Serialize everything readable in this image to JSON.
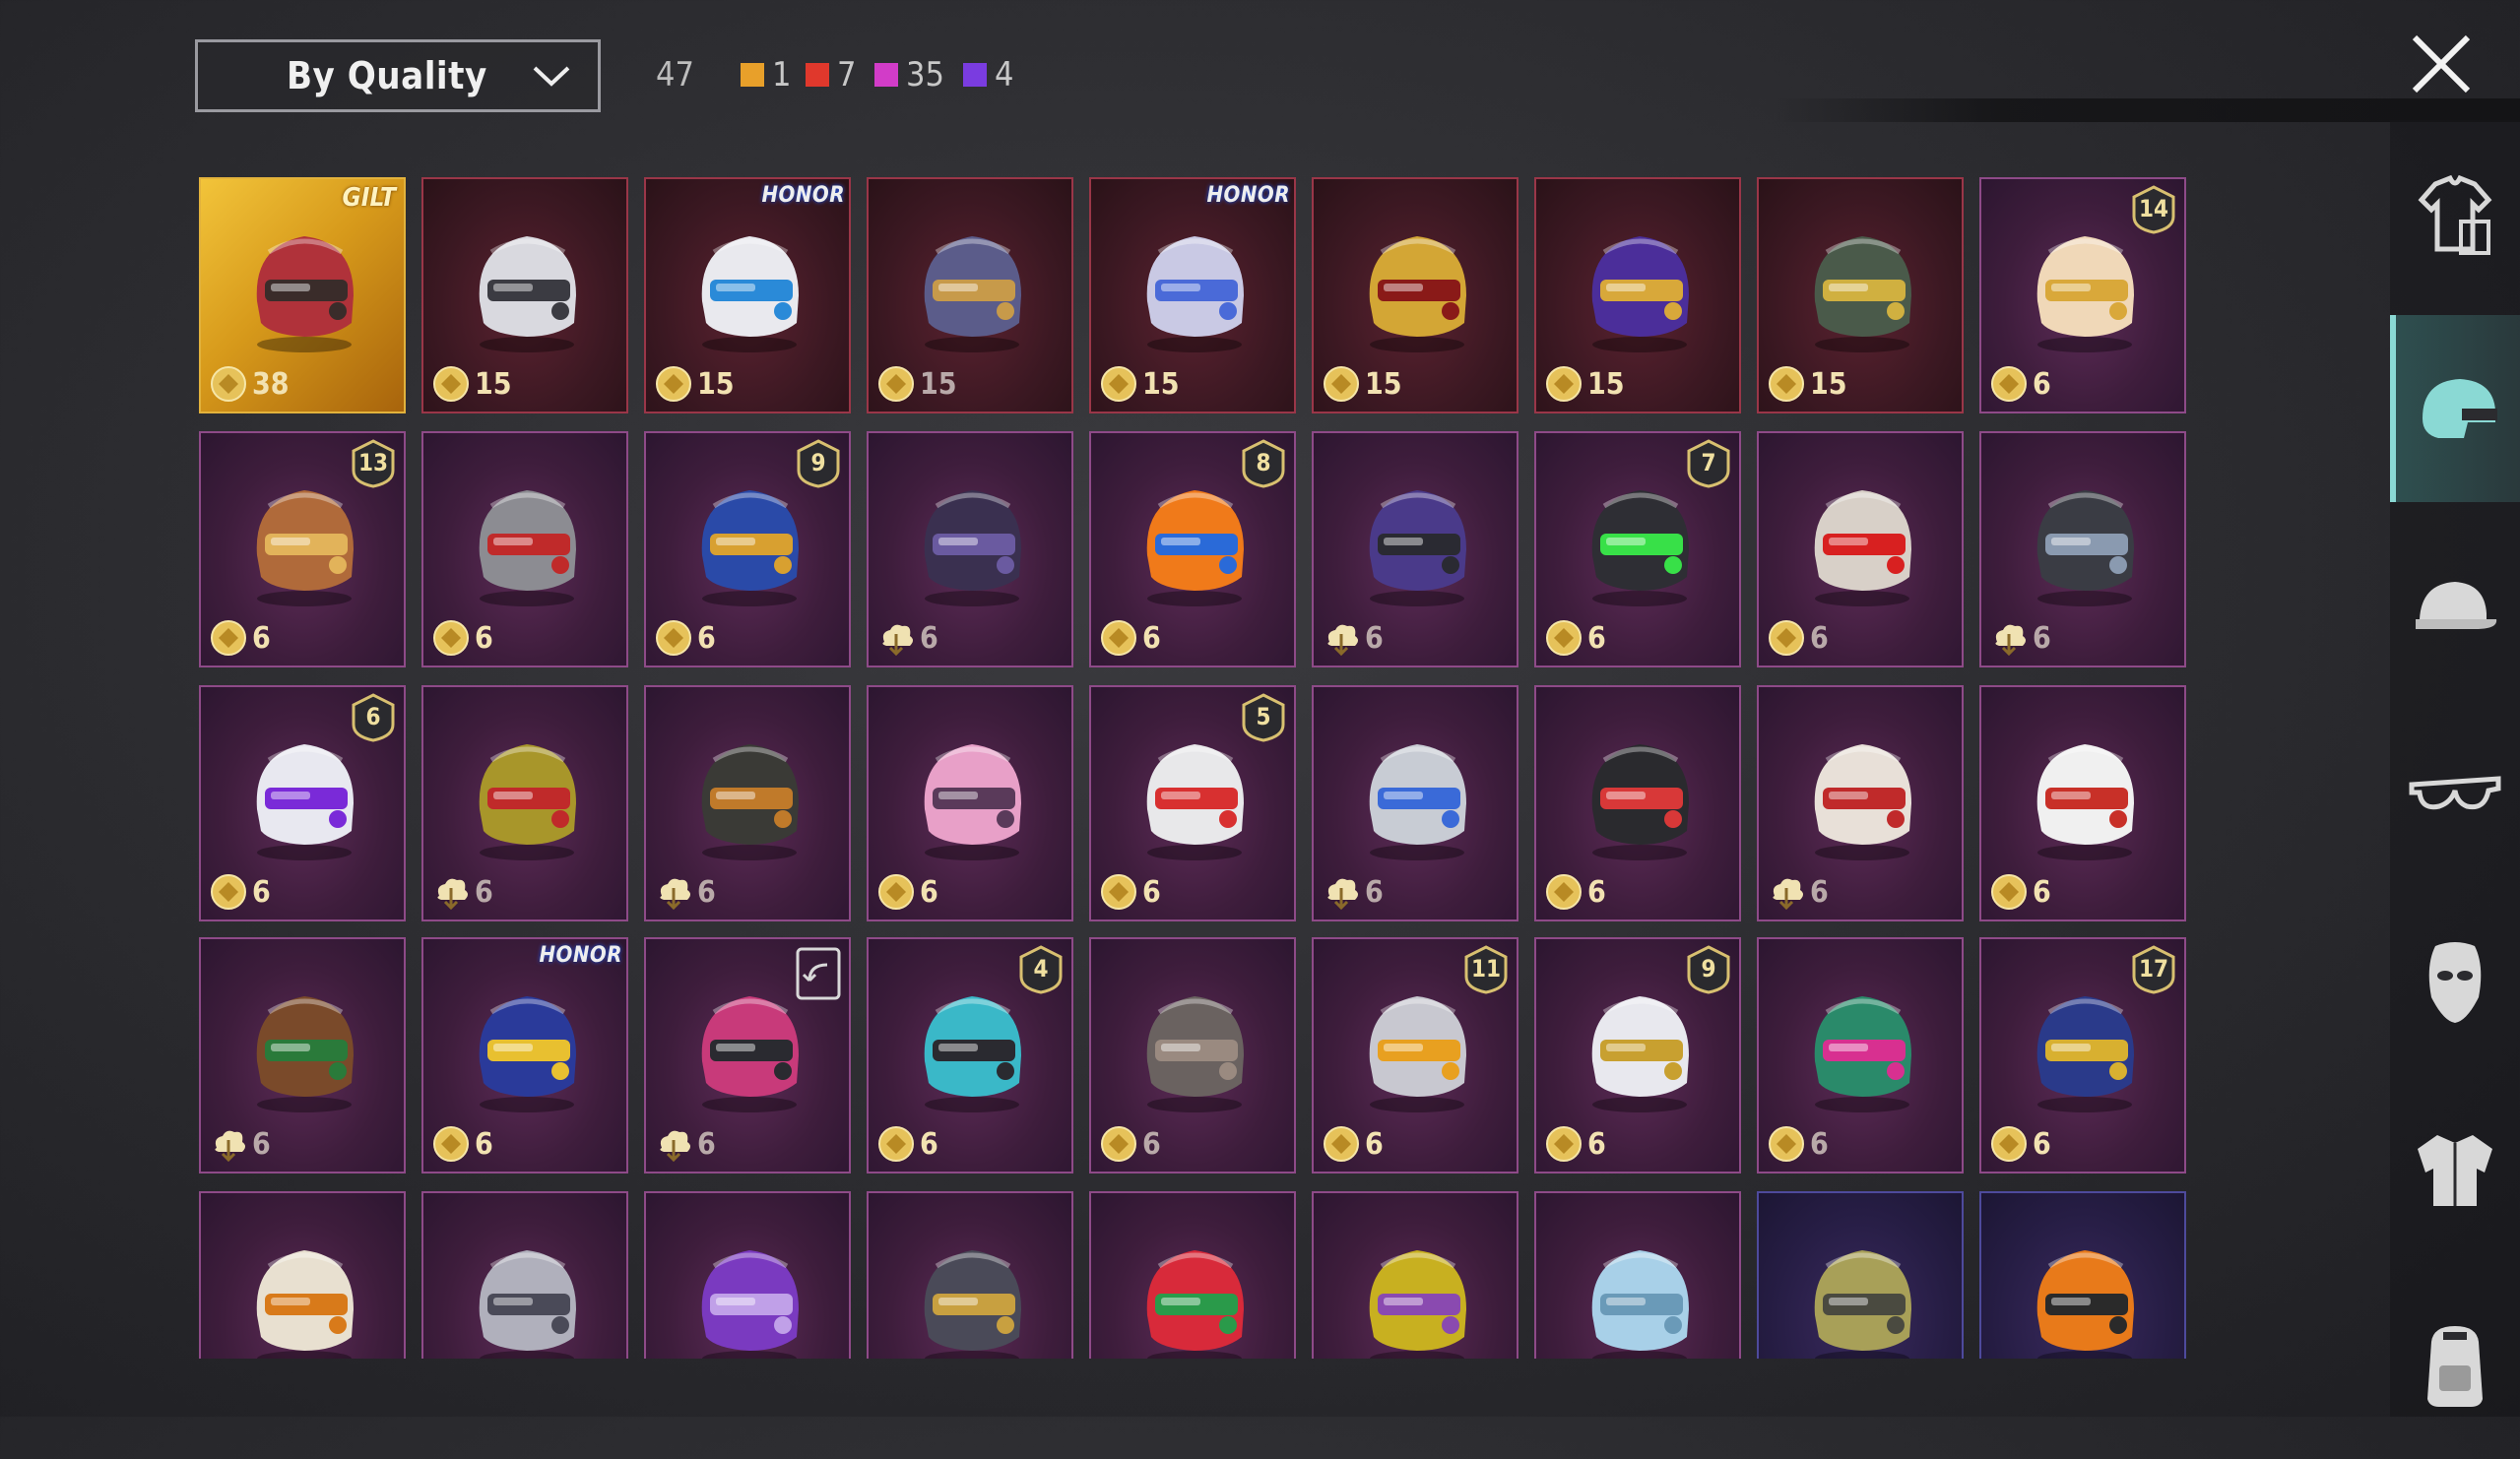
{
  "sort": {
    "label": "By Quality",
    "icon": "chevron-down-icon"
  },
  "summary": {
    "total": "47",
    "qualities": [
      {
        "name": "legendary",
        "color": "#e8a02a",
        "count": "1"
      },
      {
        "name": "mythic-red",
        "color": "#e0382c",
        "count": "7"
      },
      {
        "name": "epic-pink",
        "color": "#d23cc8",
        "count": "35"
      },
      {
        "name": "rare-purple",
        "color": "#7a3ce0",
        "count": "4"
      }
    ]
  },
  "close_icon": "close-icon",
  "sidebar": [
    {
      "name": "outfit-tab",
      "icon": "outfit-icon",
      "active": false
    },
    {
      "name": "helmet-tab",
      "icon": "helmet-icon",
      "active": true
    },
    {
      "name": "hat-tab",
      "icon": "cap-icon",
      "active": false
    },
    {
      "name": "eyewear-tab",
      "icon": "glasses-icon",
      "active": false
    },
    {
      "name": "mask-tab",
      "icon": "mask-icon",
      "active": false
    },
    {
      "name": "jacket-tab",
      "icon": "jacket-icon",
      "active": false
    },
    {
      "name": "backpack-tab",
      "icon": "backpack-icon",
      "active": false
    }
  ],
  "items": [
    {
      "quality": "gold",
      "cost": "38",
      "tag": "GILT",
      "color": "#b0323a",
      "accent": "#3a2c2a"
    },
    {
      "quality": "red",
      "cost": "15",
      "color": "#d9d9df",
      "accent": "#3b3b42"
    },
    {
      "quality": "red",
      "cost": "15",
      "tag": "HONOR",
      "color": "#e9e9ee",
      "accent": "#2a8ad8"
    },
    {
      "quality": "red",
      "cost": "15",
      "dim": true,
      "color": "#5b5c8a",
      "accent": "#c79a4a"
    },
    {
      "quality": "red",
      "cost": "15",
      "tag": "HONOR",
      "color": "#c9c9e4",
      "accent": "#4a6ad8"
    },
    {
      "quality": "red",
      "cost": "15",
      "color": "#d3a635",
      "accent": "#8a1a18"
    },
    {
      "quality": "red",
      "cost": "15",
      "color": "#4b2e9a",
      "accent": "#d8a83a"
    },
    {
      "quality": "red",
      "cost": "15",
      "color": "#4a5a4a",
      "accent": "#d0b040"
    },
    {
      "quality": "pink",
      "cost": "6",
      "badge": "14",
      "color": "#f0d8b8",
      "accent": "#d9a83a"
    },
    {
      "quality": "pink",
      "cost": "6",
      "badge": "13",
      "color": "#b06a3a",
      "accent": "#e2b35a"
    },
    {
      "quality": "pink",
      "cost": "6",
      "color": "#8c8c92",
      "accent": "#c02a2a"
    },
    {
      "quality": "pink",
      "cost": "6",
      "badge": "9",
      "color": "#2a4aa8",
      "accent": "#d8a030"
    },
    {
      "quality": "pink",
      "cost": "6",
      "dim": true,
      "share": true,
      "color": "#3a3050",
      "accent": "#6a5aa0"
    },
    {
      "quality": "pink",
      "cost": "6",
      "badge": "8",
      "color": "#f07a1a",
      "accent": "#2a6ad8"
    },
    {
      "quality": "pink",
      "cost": "6",
      "dim": true,
      "share": true,
      "color": "#4a3a8a",
      "accent": "#2a2a32"
    },
    {
      "quality": "pink",
      "cost": "6",
      "badge": "7",
      "color": "#2e2e34",
      "accent": "#38e048"
    },
    {
      "quality": "pink",
      "cost": "6",
      "dim": true,
      "color": "#d8d0c8",
      "accent": "#d82020"
    },
    {
      "quality": "pink",
      "cost": "6",
      "dim": true,
      "share": true,
      "color": "#3a3c44",
      "accent": "#8a9ab0"
    },
    {
      "quality": "pink",
      "cost": "6",
      "badge": "6",
      "color": "#e8e8f0",
      "accent": "#7a2ad8"
    },
    {
      "quality": "pink",
      "cost": "6",
      "dim": true,
      "share": true,
      "color": "#a8962a",
      "accent": "#c02a2a"
    },
    {
      "quality": "pink",
      "cost": "6",
      "dim": true,
      "share": true,
      "color": "#3a3a36",
      "accent": "#c07a2a"
    },
    {
      "quality": "pink",
      "cost": "6",
      "color": "#e8a0c8",
      "accent": "#5a3a5a"
    },
    {
      "quality": "pink",
      "cost": "6",
      "badge": "5",
      "color": "#e8e8ea",
      "accent": "#d83030"
    },
    {
      "quality": "pink",
      "cost": "6",
      "dim": true,
      "share": true,
      "color": "#c8ccd4",
      "accent": "#3a6ad8"
    },
    {
      "quality": "pink",
      "cost": "6",
      "color": "#2a2a2e",
      "accent": "#d83838"
    },
    {
      "quality": "pink",
      "cost": "6",
      "dim": true,
      "share": true,
      "color": "#e8e0d8",
      "accent": "#c02a2a"
    },
    {
      "quality": "pink",
      "cost": "6",
      "color": "#f0f0f0",
      "accent": "#c83028"
    },
    {
      "quality": "pink",
      "cost": "6",
      "dim": true,
      "share": true,
      "color": "#7a4a2a",
      "accent": "#2a7a3a"
    },
    {
      "quality": "pink",
      "cost": "6",
      "tag": "HONOR",
      "color": "#2a3a9a",
      "accent": "#e8c030"
    },
    {
      "quality": "pink",
      "cost": "6",
      "dim": true,
      "share": true,
      "swap": true,
      "color": "#c83a7a",
      "accent": "#2a2a30"
    },
    {
      "quality": "pink",
      "cost": "6",
      "badge": "4",
      "color": "#3ab8c8",
      "accent": "#2a2a30"
    },
    {
      "quality": "pink",
      "cost": "6",
      "dim": true,
      "color": "#6a6260",
      "accent": "#9a8a80"
    },
    {
      "quality": "pink",
      "cost": "6",
      "badge": "11",
      "color": "#c8c8d0",
      "accent": "#e8a020"
    },
    {
      "quality": "pink",
      "cost": "6",
      "badge": "9",
      "color": "#e8e8ee",
      "accent": "#c8a030"
    },
    {
      "quality": "pink",
      "cost": "6",
      "dim": true,
      "color": "#2a8a6a",
      "accent": "#d83090"
    },
    {
      "quality": "pink",
      "cost": "6",
      "badge": "17",
      "color": "#2a3a8a",
      "accent": "#d8b030"
    },
    {
      "quality": "pink",
      "cost": "",
      "color": "#e8e0d0",
      "accent": "#d87a1a"
    },
    {
      "quality": "pink",
      "cost": "",
      "color": "#b0b0bc",
      "accent": "#4a4a58"
    },
    {
      "quality": "pink",
      "cost": "",
      "color": "#7a3ac0",
      "accent": "#c0a0e8"
    },
    {
      "quality": "pink",
      "cost": "",
      "color": "#4a4a58",
      "accent": "#c8a040"
    },
    {
      "quality": "pink",
      "cost": "",
      "color": "#d82a3a",
      "accent": "#2a9a4a"
    },
    {
      "quality": "pink",
      "cost": "",
      "color": "#c8b020",
      "accent": "#8a4ab0"
    },
    {
      "quality": "pink",
      "cost": "",
      "color": "#a8d0e8",
      "accent": "#6a9ab8"
    },
    {
      "quality": "blue",
      "cost": "",
      "color": "#a8a058",
      "accent": "#4a4a40"
    },
    {
      "quality": "blue",
      "cost": "",
      "color": "#e87a1a",
      "accent": "#2a2a2a"
    }
  ]
}
